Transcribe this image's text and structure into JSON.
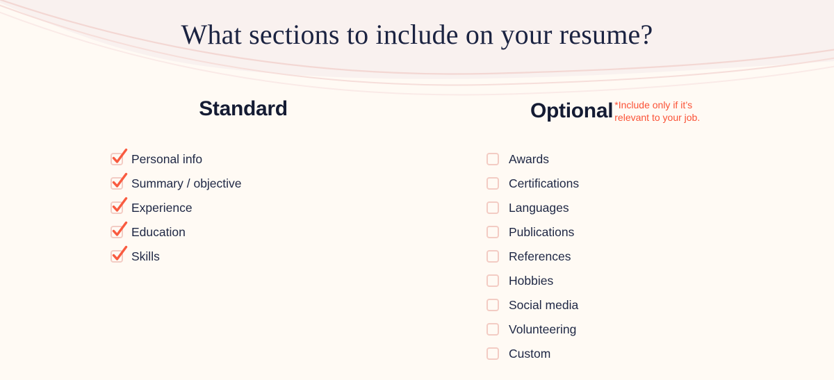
{
  "page": {
    "title": "What sections to include on your resume?",
    "background_color": "#FFFAF4",
    "tint_color": "#F9F1EF",
    "accent_color": "#FB5236",
    "ink_color": "#1B2341",
    "checkbox_border_color": "#F3CCC4"
  },
  "columns": {
    "standard": {
      "heading": "Standard",
      "items": [
        {
          "label": "Personal info",
          "checked": true
        },
        {
          "label": "Summary / objective",
          "checked": true
        },
        {
          "label": "Experience",
          "checked": true
        },
        {
          "label": "Education",
          "checked": true
        },
        {
          "label": "Skills",
          "checked": true
        }
      ]
    },
    "optional": {
      "heading": "Optional",
      "note_star": "*",
      "note_line1": "Include only if it’s",
      "note_line2": "relevant to your job.",
      "items": [
        {
          "label": "Awards",
          "checked": false
        },
        {
          "label": "Certifications",
          "checked": false
        },
        {
          "label": "Languages",
          "checked": false
        },
        {
          "label": "Publications",
          "checked": false
        },
        {
          "label": "References",
          "checked": false
        },
        {
          "label": "Hobbies",
          "checked": false
        },
        {
          "label": "Social media",
          "checked": false
        },
        {
          "label": "Volunteering",
          "checked": false
        },
        {
          "label": "Custom",
          "checked": false
        }
      ]
    }
  },
  "icons": {
    "checkmark": "check-icon",
    "empty_box": "checkbox-empty-icon"
  }
}
